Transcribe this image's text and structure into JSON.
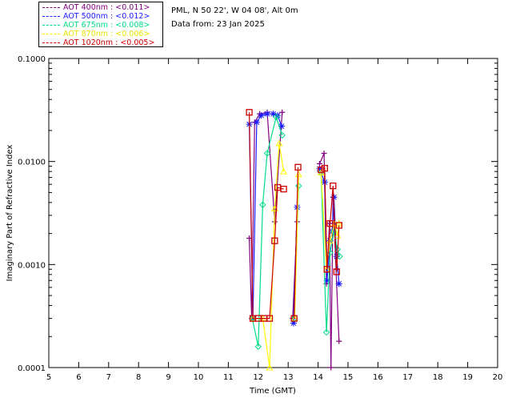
{
  "header": {
    "location": "PML, N 50 22', W 04 08', Alt 0m",
    "date_line": "Data from: 23 Jan 2025"
  },
  "legend": [
    {
      "label": "AOT  400nm : <0.011>",
      "color": "#800080"
    },
    {
      "label": "AOT  500nm : <0.012>",
      "color": "#1a1aff"
    },
    {
      "label": "AOT  675nm : <0.008>",
      "color": "#00dd88"
    },
    {
      "label": "AOT  870nm : <0.006>",
      "color": "#ffff00"
    },
    {
      "label": "AOT 1020nm : <0.005>",
      "color": "#cc0000"
    }
  ],
  "chart_data": {
    "type": "line",
    "xlabel": "Time (GMT)",
    "ylabel": "Imaginary Part of Refractive Index",
    "xlim": [
      5,
      20
    ],
    "ylim": [
      0.0001,
      0.1
    ],
    "yscale": "log",
    "xticks": [
      "5",
      "6",
      "7",
      "8",
      "9",
      "10",
      "11",
      "12",
      "13",
      "14",
      "15",
      "16",
      "17",
      "18",
      "19",
      "20"
    ],
    "yticks": [
      {
        "value": 0.1,
        "label": "0.1000"
      },
      {
        "value": 0.01,
        "label": "0.0100"
      },
      {
        "value": 0.001,
        "label": "0.0010"
      },
      {
        "value": 0.0001,
        "label": "0.0001"
      }
    ],
    "series": [
      {
        "name": "AOT  400nm",
        "color": "#800080",
        "marker": "plus",
        "points": [
          [
            11.7,
            0.0018
          ],
          [
            11.78,
            0.0003
          ],
          [
            11.88,
            0.024
          ],
          [
            12.05,
            0.029
          ],
          [
            12.3,
            0.03
          ],
          [
            12.55,
            0.0026
          ],
          [
            12.8,
            0.03
          ],
          null,
          [
            13.15,
            0.0003
          ],
          [
            13.3,
            0.0026
          ],
          null,
          [
            14.05,
            0.0095
          ],
          [
            14.2,
            0.012
          ],
          [
            14.28,
            0.00065
          ],
          [
            14.38,
            0.0025
          ],
          [
            14.43,
            0.0001
          ],
          [
            14.5,
            0.0045
          ],
          [
            14.6,
            0.0009
          ],
          [
            14.7,
            0.00018
          ]
        ]
      },
      {
        "name": "AOT  500nm",
        "color": "#1a1aff",
        "marker": "star",
        "points": [
          [
            11.7,
            0.023
          ],
          [
            11.82,
            0.0003
          ],
          [
            11.95,
            0.024
          ],
          [
            12.1,
            0.028
          ],
          [
            12.3,
            0.029
          ],
          [
            12.5,
            0.029
          ],
          [
            12.65,
            0.028
          ],
          [
            12.78,
            0.022
          ],
          null,
          [
            13.18,
            0.00027
          ],
          [
            13.3,
            0.0036
          ],
          null,
          [
            14.05,
            0.0085
          ],
          [
            14.22,
            0.0063
          ],
          [
            14.3,
            0.0007
          ],
          [
            14.4,
            0.0017
          ],
          [
            14.47,
            0.0021
          ],
          [
            14.53,
            0.0045
          ],
          [
            14.62,
            0.0012
          ],
          [
            14.7,
            0.00065
          ]
        ]
      },
      {
        "name": "AOT  675nm",
        "color": "#00dd88",
        "marker": "diamond",
        "points": [
          [
            11.8,
            0.0003
          ],
          [
            12.0,
            0.00016
          ],
          [
            12.15,
            0.0038
          ],
          [
            12.3,
            0.012
          ],
          [
            12.6,
            0.027
          ],
          [
            12.8,
            0.018
          ],
          null,
          [
            13.2,
            0.0003
          ],
          [
            13.35,
            0.0058
          ],
          null,
          [
            14.1,
            0.0078
          ],
          [
            14.28,
            0.00022
          ],
          [
            14.4,
            0.0013
          ],
          [
            14.53,
            0.0021
          ],
          [
            14.65,
            0.0014
          ],
          [
            14.72,
            0.0012
          ]
        ]
      },
      {
        "name": "AOT  870nm",
        "color": "#ffff00",
        "marker": "triangle",
        "points": [
          [
            11.82,
            0.0003
          ],
          [
            12.15,
            0.0003
          ],
          [
            12.38,
            0.0001
          ],
          [
            12.55,
            0.0035
          ],
          [
            12.7,
            0.015
          ],
          [
            12.85,
            0.008
          ],
          null,
          [
            13.22,
            0.0003
          ],
          [
            13.35,
            0.0075
          ],
          null,
          [
            14.1,
            0.0078
          ],
          [
            14.28,
            0.0009
          ],
          [
            14.4,
            0.0017
          ],
          [
            14.55,
            0.0025
          ],
          [
            14.65,
            0.0019
          ],
          [
            14.7,
            0.0025
          ]
        ]
      },
      {
        "name": "AOT 1020nm",
        "color": "#cc0000",
        "marker": "square",
        "points": [
          [
            11.7,
            0.03
          ],
          [
            11.82,
            0.0003
          ],
          [
            12.0,
            0.0003
          ],
          [
            12.2,
            0.0003
          ],
          [
            12.38,
            0.0003
          ],
          [
            12.55,
            0.0017
          ],
          [
            12.65,
            0.0056
          ],
          [
            12.85,
            0.0054
          ],
          null,
          [
            13.2,
            0.0003
          ],
          [
            13.33,
            0.0088
          ],
          null,
          [
            14.1,
            0.0083
          ],
          [
            14.22,
            0.0086
          ],
          [
            14.3,
            0.0009
          ],
          [
            14.4,
            0.0025
          ],
          [
            14.5,
            0.0058
          ],
          [
            14.62,
            0.00085
          ],
          [
            14.7,
            0.0024
          ]
        ]
      }
    ]
  }
}
